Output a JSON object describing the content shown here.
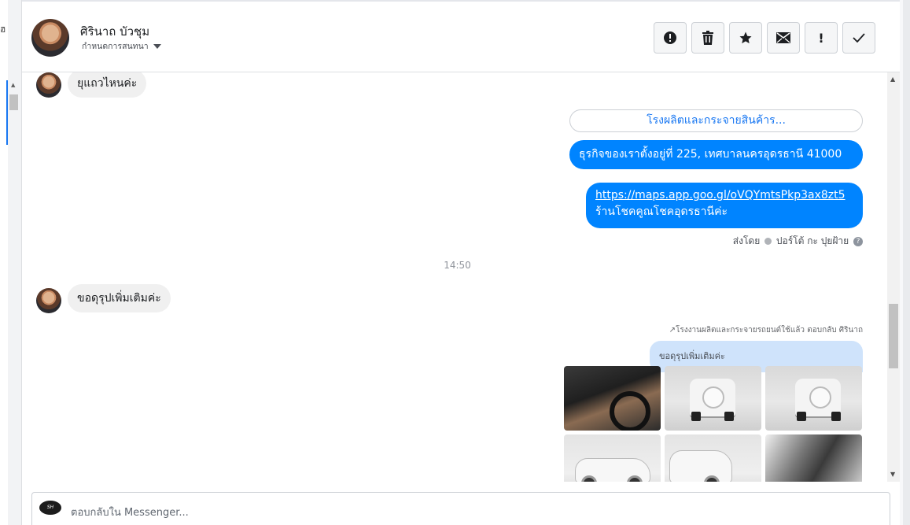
{
  "left": {
    "glyph": "ฮ"
  },
  "header": {
    "name": "ศิรินาถ บัวชุม",
    "subtitle": "กำหนดการสนทนา",
    "toolbar": [
      {
        "icon": "alert-circle-icon",
        "glyph": "❗"
      },
      {
        "icon": "trash-icon",
        "glyph": "🗑"
      },
      {
        "icon": "star-icon",
        "glyph": "★"
      },
      {
        "icon": "envelope-icon",
        "glyph": "✉"
      },
      {
        "icon": "exclamation-icon",
        "glyph": "!"
      },
      {
        "icon": "check-icon",
        "glyph": "✓"
      }
    ]
  },
  "messages": {
    "first_incoming": "ยุแถวไหนค่ะ",
    "button_pill": "โรงผลิตและกระจายสินค้าร...",
    "address": "ธุรกิจของเราตั้งอยู่ที่ 225, เทศบาลนครอุดรธานี 41000",
    "map_link": "https://maps.app.goo.gl/oVQYmtsPkp3ax8zt5",
    "map_caption": "ร้านโชคคูณโชคอุดรธานีค่ะ",
    "sent_by_prefix": "ส่งโดย",
    "sent_by_name": "ปอร์โต้ กะ ปุยฝ้าย",
    "time": "14:50",
    "second_incoming": "ขอดุรุปเพิ่มเติมค่ะ",
    "reply_note": "โรงงานผลิตและกระจายรถยนต์ใช้แล้ว ตอบกลับ ศิรินาถ",
    "quoted_text": "ขอดุรุปเพิ่มเติมค่ะ"
  },
  "composer": {
    "placeholder": "ตอบกลับใน Messenger...",
    "logo_text": "SH"
  },
  "colors": {
    "accent": "#0084ff",
    "link": "#1877f2",
    "incoming_bg": "#f0f0f0",
    "quoted_bg": "#cfe3fb"
  }
}
